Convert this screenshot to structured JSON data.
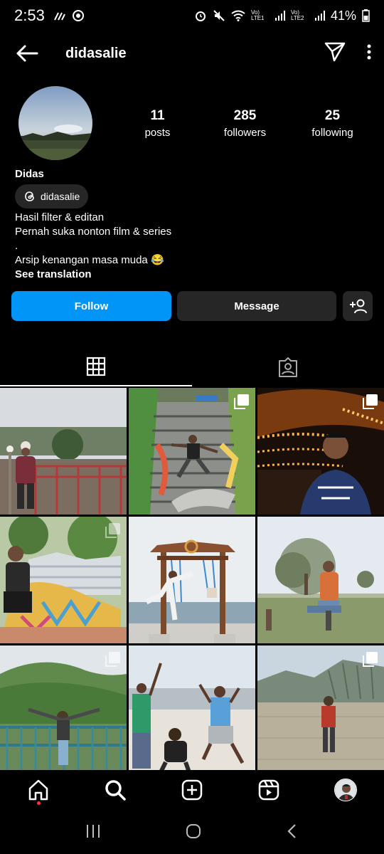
{
  "status_bar": {
    "time": "2:53",
    "battery": "41%",
    "sim1": "Vo) LTE1",
    "sim2": "Vo) LTE2"
  },
  "header": {
    "username": "didasalie",
    "icons": [
      "back-arrow-icon",
      "send-icon",
      "more-vertical-icon"
    ]
  },
  "profile": {
    "stats": [
      {
        "value": "11",
        "label": "posts"
      },
      {
        "value": "285",
        "label": "followers"
      },
      {
        "value": "25",
        "label": "following"
      }
    ],
    "display_name": "Didas",
    "threads_handle": "didasalie",
    "bio_lines": [
      "Hasil filter & editan",
      "Pernah suka nonton film & series",
      ".",
      "Arsip kenangan masa muda 😂"
    ],
    "see_translation": "See translation"
  },
  "actions": {
    "follow": "Follow",
    "message": "Message"
  },
  "tabs": [
    "grid-icon",
    "tagged-icon"
  ],
  "accent_color": "#0095f6"
}
